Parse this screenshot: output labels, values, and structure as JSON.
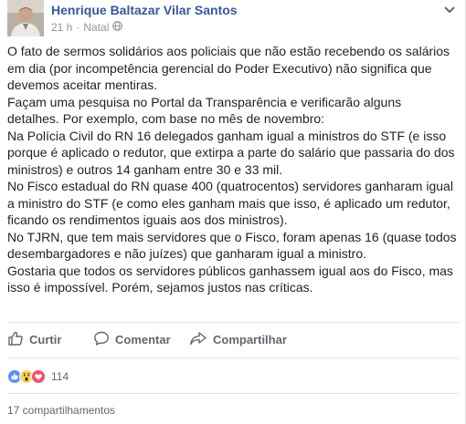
{
  "post": {
    "author": "Henrique Baltazar Vilar Santos",
    "time": "21 h",
    "separator": "·",
    "location": "Natal",
    "body_lines": [
      "O fato de sermos solidários aos policiais que não estão recebendo os salários",
      "em dia (por incompetência gerencial do Poder Executivo) não significa que",
      "devemos aceitar mentiras.",
      "Façam uma pesquisa no Portal da Transparência e verificarão alguns",
      "detalhes. Por exemplo, com base no mês de novembro:",
      "Na Polícia Civil do RN 16 delegados ganham igual a ministros do STF (e isso",
      "porque é aplicado o redutor, que extirpa a parte do salário que passaria do dos",
      "ministros) e outros 14 ganham entre 30 e 33 mil.",
      "No Fisco estadual do RN quase 400 (quatrocentos) servidores ganharam igual",
      "a ministro do STF (e como eles ganham mais que isso, é aplicado um redutor,",
      "ficando os rendimentos iguais aos dos ministros).",
      "No TJRN, que tem mais servidores que o Fisco, foram apenas 16 (quase todos",
      "desembargadores e não juízes) que ganharam igual a ministro.",
      "Gostaria que todos os servidores públicos ganhassem igual aos do Fisco, mas",
      "isso é impossível. Porém, sejamos justos nas críticas."
    ]
  },
  "actions": {
    "like": "Curtir",
    "comment": "Comentar",
    "share": "Compartilhar"
  },
  "reactions": {
    "types": [
      "like-icon",
      "wow-icon",
      "love-icon"
    ],
    "count": "114"
  },
  "shares": {
    "label": "17 compartilhamentos"
  },
  "colors": {
    "author_link": "#365899",
    "meta_gray": "#90949c",
    "action_gray": "#606770",
    "like_blue": "#5890ff",
    "love_red": "#f25268",
    "wow_yellow": "#fcd562"
  }
}
